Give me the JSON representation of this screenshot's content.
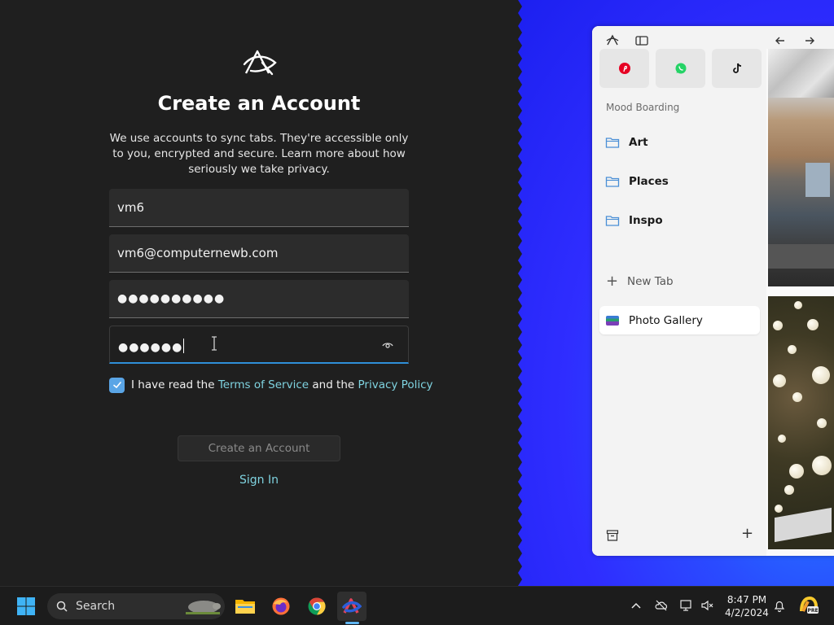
{
  "signup": {
    "title": "Create an Account",
    "intro": "We use accounts to sync tabs. They're accessible only to you, encrypted and secure. Learn more about how seriously we take privacy.",
    "fields": {
      "username": "vm6",
      "email": "vm6@computernewb.com",
      "password": "●●●●●●●●●●",
      "confirm_password": "●●●●●●"
    },
    "agree": {
      "checked": true,
      "prefix": "I have read the ",
      "terms": "Terms of Service",
      "middle": " and the ",
      "privacy": "Privacy Policy"
    },
    "create_button": "Create an Account",
    "sign_in": "Sign In"
  },
  "arc": {
    "favorites": [
      "pinterest-icon",
      "whatsapp-icon",
      "tiktok-icon"
    ],
    "section_label": "Mood Boarding",
    "folders": [
      "Art",
      "Places",
      "Inspo"
    ],
    "new_tab": "New Tab",
    "active_tab": "Photo Gallery"
  },
  "taskbar": {
    "search_label": "Search",
    "apps": [
      "file-explorer-icon",
      "firefox-icon",
      "chrome-icon",
      "arc-icon"
    ],
    "time": "8:47 PM",
    "date": "4/2/2024"
  },
  "colors": {
    "accent_link": "#7fd3e0",
    "checkbox": "#5aa5e6",
    "active_underline": "#2f8fd8",
    "desktop_blue": "#2a4cff"
  }
}
